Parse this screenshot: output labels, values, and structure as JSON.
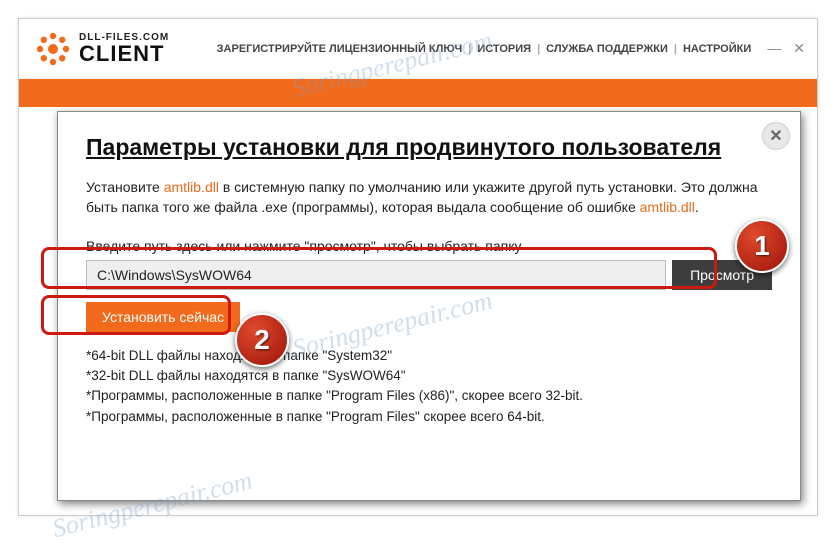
{
  "header": {
    "brand_small": "DLL-FILES.COM",
    "brand_big": "CLIENT",
    "links": {
      "register": "ЗАРЕГИСТРИРУЙТЕ ЛИЦЕНЗИОННЫЙ КЛЮЧ",
      "history": "ИСТОРИЯ",
      "support": "СЛУЖБА ПОДДЕРЖКИ",
      "settings": "НАСТРОЙКИ"
    }
  },
  "dialog": {
    "title": "Параметры установки для продвинутого пользователя",
    "intro1a": "Установите ",
    "dllname1": "amtlib.dll",
    "intro1b": " в системную папку по умолчанию или укажите другой путь установки. Это должна быть папка того же файла .exe (программы), которая выдала сообщение об ошибке ",
    "dllname2": "amtlib.dll",
    "intro1c": ".",
    "input_label": "Введите путь здесь или нажмите \"просмотр\", чтобы выбрать папку",
    "path_value": "C:\\Windows\\SysWOW64",
    "browse": "Просмотр",
    "install": "Установить сейчас",
    "notes": {
      "n1": "*64-bit DLL файлы находятся в папке \"System32\"",
      "n2": "*32-bit DLL файлы находятся в папке \"SysWOW64\"",
      "n3": "*Программы, расположенные в папке \"Program Files (x86)\", скорее всего 32-bit.",
      "n4": "*Программы, расположенные в папке \"Program Files\" скорее всего 64-bit."
    }
  },
  "steps": {
    "one": "1",
    "two": "2"
  },
  "watermark": "Soringperepair.com",
  "icons": {
    "minimize": "—",
    "close": "✕",
    "dialog_close": "✕"
  },
  "colors": {
    "accent": "#f26a1b",
    "callout": "#cc1a11"
  }
}
